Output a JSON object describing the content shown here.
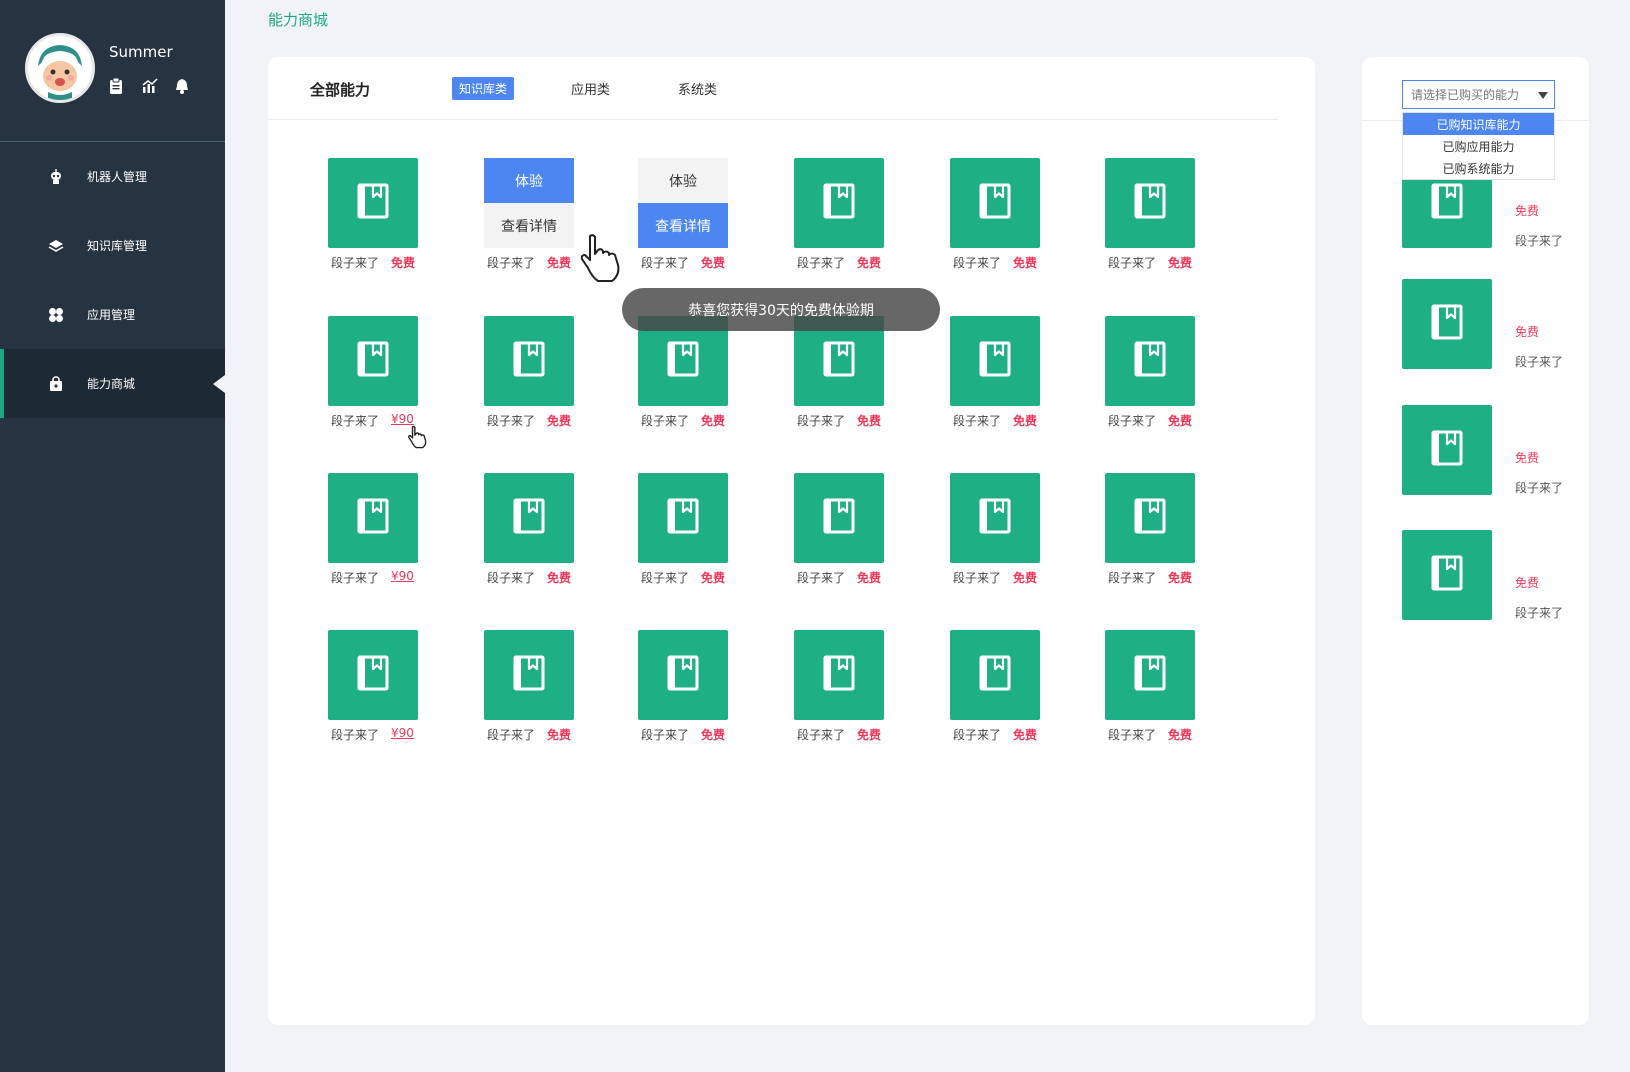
{
  "user": {
    "name": "Summer"
  },
  "sidebar": {
    "items": [
      {
        "label": "机器人管理",
        "icon": "robot-icon"
      },
      {
        "label": "知识库管理",
        "icon": "layers-icon"
      },
      {
        "label": "应用管理",
        "icon": "apps-icon"
      },
      {
        "label": "能力商城",
        "icon": "shop-bag-icon",
        "active": true
      }
    ]
  },
  "breadcrumb": "能力商城",
  "tabs": {
    "all": "全部能力",
    "items": [
      "知识库类",
      "应用类",
      "系统类"
    ],
    "active_index": 0
  },
  "hover_menu": {
    "try": "体验",
    "details": "查看详情"
  },
  "toast": "恭喜您获得30天的免费体验期",
  "grid": {
    "rows": [
      [
        {
          "label": "段子来了",
          "price": "免费"
        },
        {
          "label": "段子来了",
          "price": "免费",
          "menu": "try"
        },
        {
          "label": "段子来了",
          "price": "免费",
          "menu": "details"
        },
        {
          "label": "段子来了",
          "price": "免费"
        },
        {
          "label": "段子来了",
          "price": "免费"
        },
        {
          "label": "段子来了",
          "price": "免费"
        }
      ],
      [
        {
          "label": "段子来了",
          "price": "¥90"
        },
        {
          "label": "段子来了",
          "price": "免费"
        },
        {
          "label": "段子来了",
          "price": "免费"
        },
        {
          "label": "段子来了",
          "price": "免费"
        },
        {
          "label": "段子来了",
          "price": "免费"
        },
        {
          "label": "段子来了",
          "price": "免费"
        }
      ],
      [
        {
          "label": "段子来了",
          "price": "¥90"
        },
        {
          "label": "段子来了",
          "price": "免费"
        },
        {
          "label": "段子来了",
          "price": "免费"
        },
        {
          "label": "段子来了",
          "price": "免费"
        },
        {
          "label": "段子来了",
          "price": "免费"
        },
        {
          "label": "段子来了",
          "price": "免费"
        }
      ],
      [
        {
          "label": "段子来了",
          "price": "¥90"
        },
        {
          "label": "段子来了",
          "price": "免费"
        },
        {
          "label": "段子来了",
          "price": "免费"
        },
        {
          "label": "段子来了",
          "price": "免费"
        },
        {
          "label": "段子来了",
          "price": "免费"
        },
        {
          "label": "段子来了",
          "price": "免费"
        }
      ]
    ]
  },
  "right_panel": {
    "select_placeholder": "请选择已购买的能力",
    "options": [
      "已购知识库能力",
      "已购应用能力",
      "已购系统能力"
    ],
    "selected_index": 0,
    "items": [
      {
        "price": "免费",
        "label": "段子来了"
      },
      {
        "price": "免费",
        "label": "段子来了"
      },
      {
        "price": "免费",
        "label": "段子来了"
      },
      {
        "price": "免费",
        "label": "段子来了"
      }
    ]
  },
  "colors": {
    "sidebar": "#263341",
    "accent_green": "#1faf85",
    "accent_blue": "#4d86f0",
    "price_red": "#f0395a"
  }
}
